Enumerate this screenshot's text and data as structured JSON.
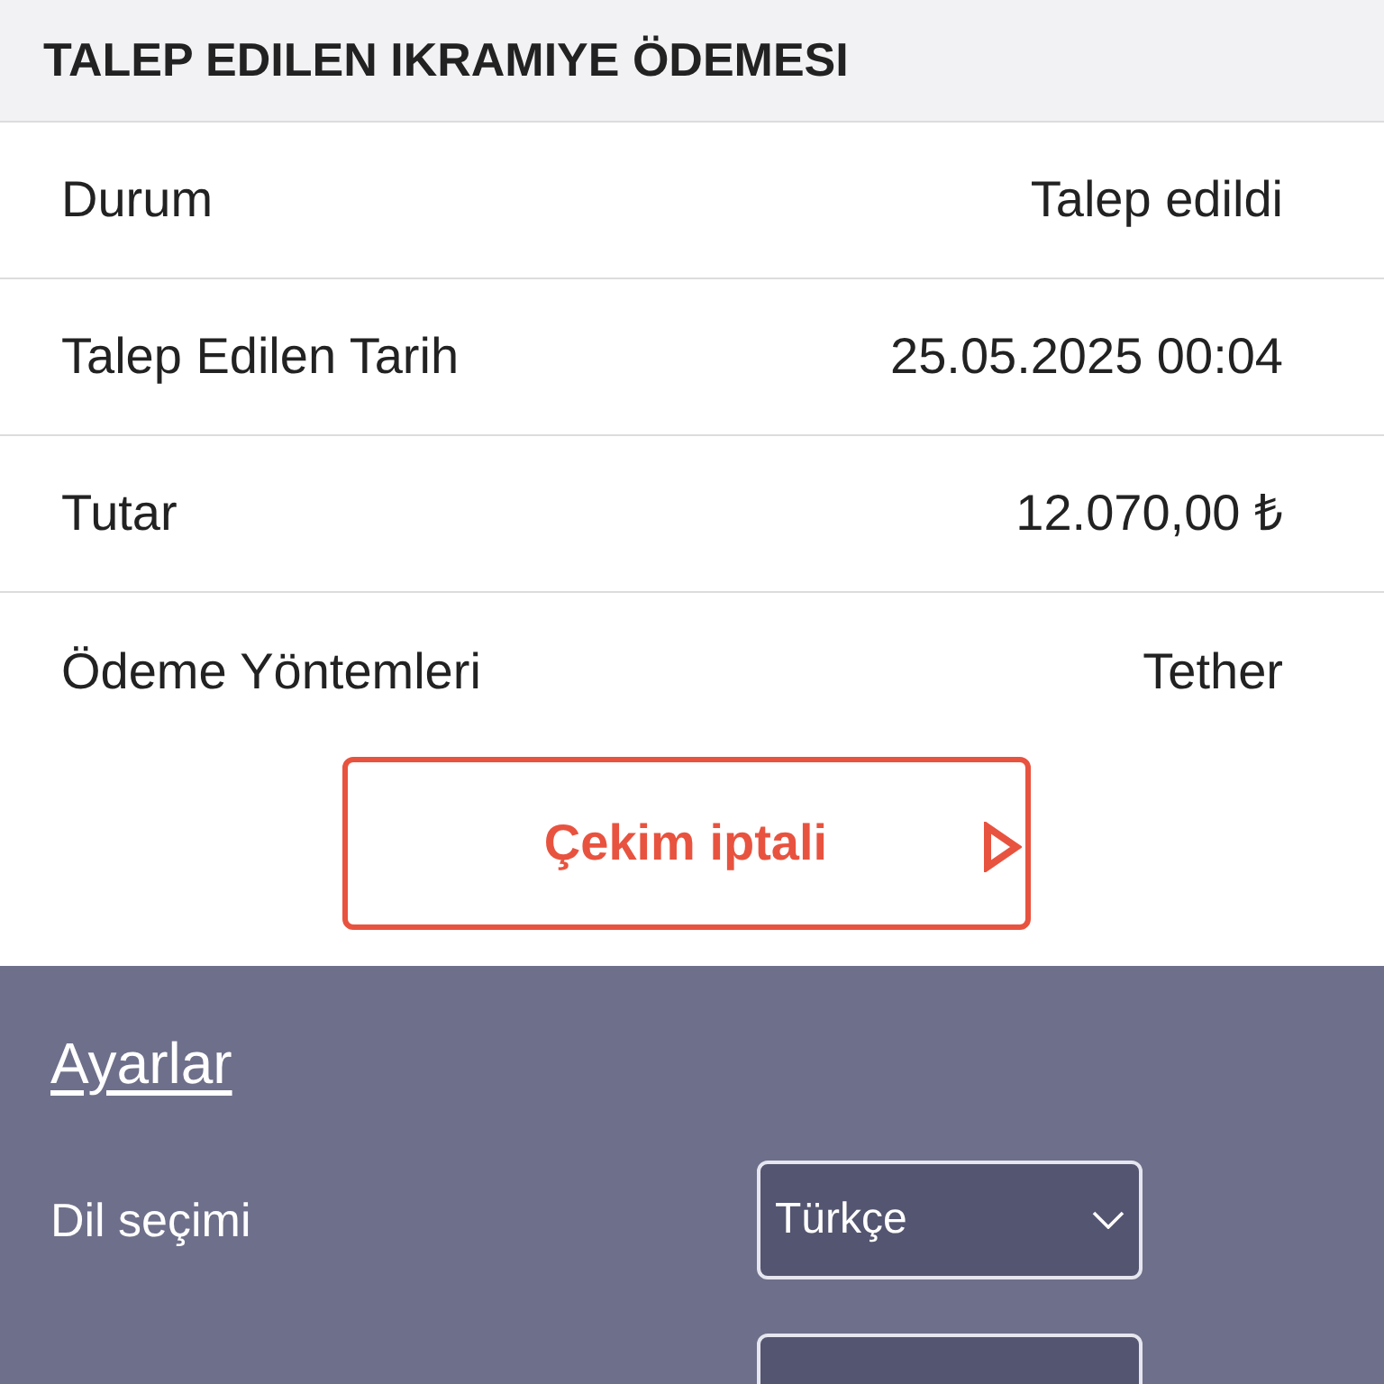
{
  "header": {
    "title": "TALEP EDILEN IKRAMIYE ÖDEMESI"
  },
  "details": [
    {
      "label": "Durum",
      "value": "Talep edildi"
    },
    {
      "label": "Talep Edilen Tarih",
      "value": "25.05.2025 00:04"
    },
    {
      "label": "Tutar",
      "value": "12.070,00 ₺"
    },
    {
      "label": "Ödeme Yöntemleri",
      "value": "Tether"
    }
  ],
  "cancel_button": {
    "label": "Çekim iptali"
  },
  "settings": {
    "title": "Ayarlar",
    "language": {
      "label": "Dil seçimi",
      "value": "Türkçe"
    }
  }
}
